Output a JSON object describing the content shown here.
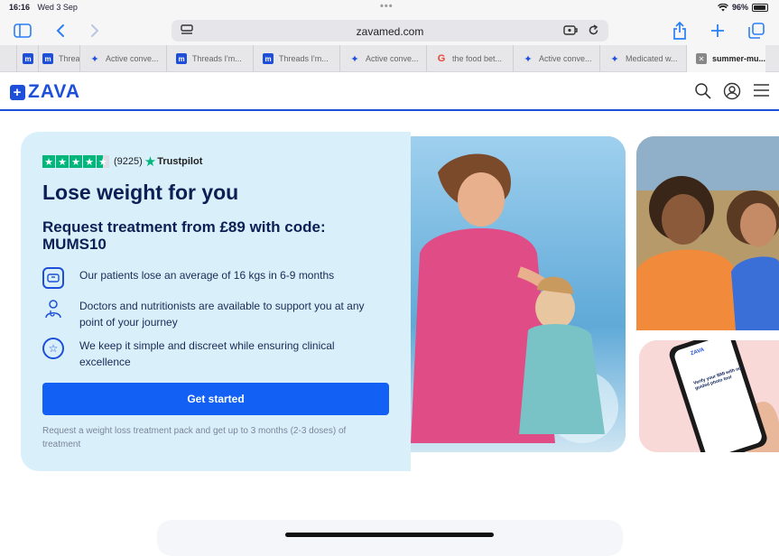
{
  "status": {
    "time": "16:16",
    "date": "Wed 3 Sep",
    "dots": "•••",
    "wifi": "wifi",
    "battery": "96%"
  },
  "browser": {
    "url": "zavamed.com",
    "tabs": [
      {
        "label": "",
        "favicon": "m"
      },
      {
        "label": "Threa",
        "favicon": "m"
      },
      {
        "label": "Active conve...",
        "favicon": "w"
      },
      {
        "label": "Threads I'm...",
        "favicon": "m"
      },
      {
        "label": "Threads I'm...",
        "favicon": "m"
      },
      {
        "label": "Active conve...",
        "favicon": "w"
      },
      {
        "label": "the food bet...",
        "favicon": "g"
      },
      {
        "label": "Active conve...",
        "favicon": "w"
      },
      {
        "label": "Medicated w...",
        "favicon": "w"
      },
      {
        "label": "summer-mu...",
        "favicon": "x"
      }
    ]
  },
  "site": {
    "logo": "ZAVA"
  },
  "hero": {
    "rating_count": "(9225)",
    "trustpilot": "Trustpilot",
    "title": "Lose weight for you",
    "subtitle": "Request treatment from £89 with code: MUMS10",
    "features": [
      "Our patients lose an average of 16 kgs in 6-9 months",
      "Doctors and nutritionists are available to support you at any point of your journey",
      "We keep it simple and discreet while ensuring clinical excellence"
    ],
    "cta": "Get started",
    "note": "Request a weight loss treatment pack and get up to 3 months (2-3 doses) of treatment"
  },
  "phone": {
    "brand": "ZAVA",
    "heading": "Verify your BMI with our guided photo tool"
  },
  "colors": {
    "brand": "#1d4fd8",
    "cta": "#1360f5",
    "hero_bg": "#d9f0fb",
    "trustpilot": "#00b67a"
  }
}
